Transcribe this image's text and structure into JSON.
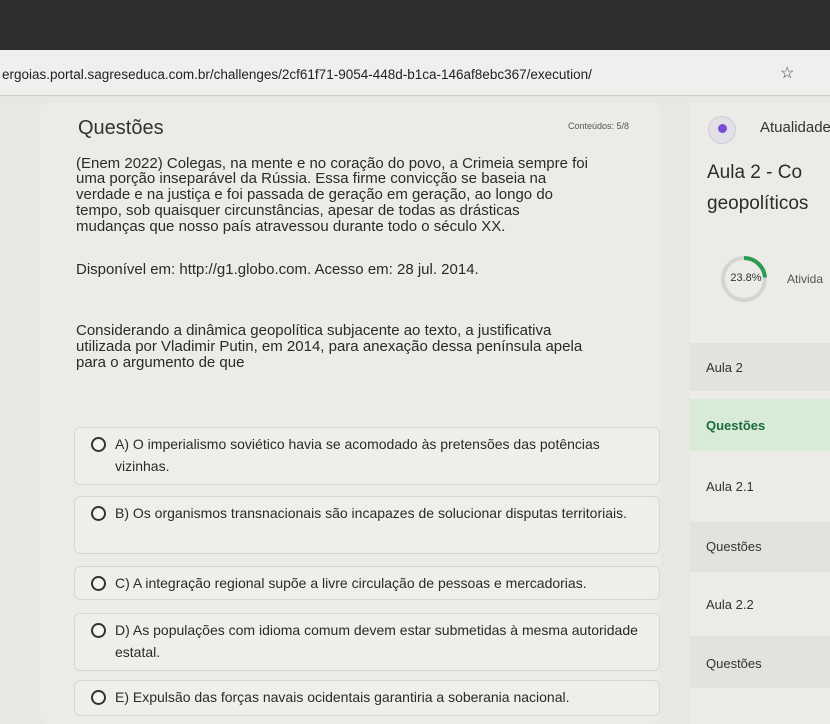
{
  "browser": {
    "url": "ergoias.portal.sagreseduca.com.br/challenges/2cf61f71-9054-448d-b1ca-146af8ebc367/execution/",
    "star_icon": "star-icon"
  },
  "question": {
    "heading": "Questões",
    "counter": "Conteúdos: 5/8",
    "text_lines": [
      "(Enem 2022) Colegas, na mente e no coração do povo, a Crimeia sempre foi",
      "uma porção inseparável da Rússia. Essa firme convicção se baseia na",
      "verdade e na justiça e foi passada de geração em geração, ao longo do",
      "tempo, sob quaisquer circunstâncias, apesar de todas as drásticas",
      "mudanças que nosso país atravessou durante todo o século XX."
    ],
    "source": "Disponível em: http://g1.globo.com. Acesso em: 28 jul. 2014.",
    "prompt_lines": [
      "Considerando a dinâmica geopolítica subjacente ao texto, a justificativa",
      "utilizada por Vladimir Putin, em 2014, para anexação dessa península apela",
      "para o argumento de que"
    ],
    "options": [
      {
        "label": "A) O imperialismo soviético havia se acomodado às pretensões das potências vizinhas."
      },
      {
        "label": "B) Os organismos transnacionais são incapazes de solucionar disputas territoriais."
      },
      {
        "label": "C) A integração regional supõe a livre circulação de pessoas e mercadorias."
      },
      {
        "label": "D) As populações com idioma comum devem estar submetidas à mesma autoridade estatal."
      },
      {
        "label": "E) Expulsão das forças navais ocidentais garantiria a soberania nacional."
      }
    ]
  },
  "sidebar": {
    "atualidade": "Atualidade",
    "aula_title": "Aula 2 - Co",
    "aula_subtitle": "geopolíticos",
    "progress_text": "23.8%",
    "progress_value": 0.238,
    "atividade": "Ativida",
    "nav": [
      {
        "label": "Aula 2"
      },
      {
        "label": "Questões"
      },
      {
        "label": "Aula 2.1"
      },
      {
        "label": "Questões"
      },
      {
        "label": "Aula 2.2"
      },
      {
        "label": "Questões"
      }
    ],
    "accent_color": "#1d6a3a",
    "progress_color": "#2e9b52"
  }
}
